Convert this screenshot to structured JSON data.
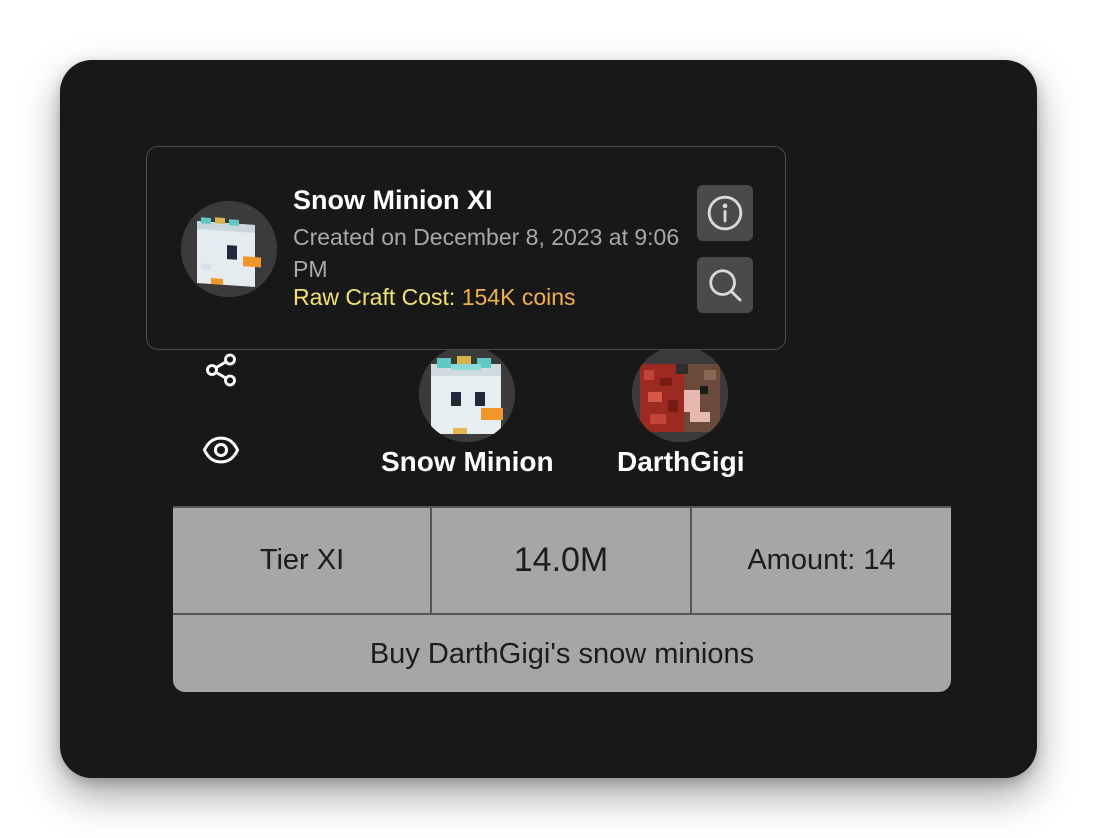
{
  "popup": {
    "title": "Snow Minion XI",
    "created": "Created on December 8, 2023 at 9:06 PM",
    "cost_label": "Raw Craft Cost:",
    "cost_value": "154K coins",
    "info_icon": "info-icon",
    "search_icon": "search-icon"
  },
  "side_actions": [
    {
      "icon": "share-icon"
    },
    {
      "icon": "eye-icon"
    }
  ],
  "item": {
    "name": "Snow Minion"
  },
  "seller": {
    "name": "DarthGigi"
  },
  "table": {
    "tier": "Tier XI",
    "price": "14.0M",
    "amount": "Amount: 14",
    "buy_label": "Buy DarthGigi's snow minions"
  },
  "colors": {
    "card_bg": "#181818",
    "cost_label": "#f2e36a",
    "cost_value": "#efb245",
    "table_bg": "#a6a6a6"
  }
}
